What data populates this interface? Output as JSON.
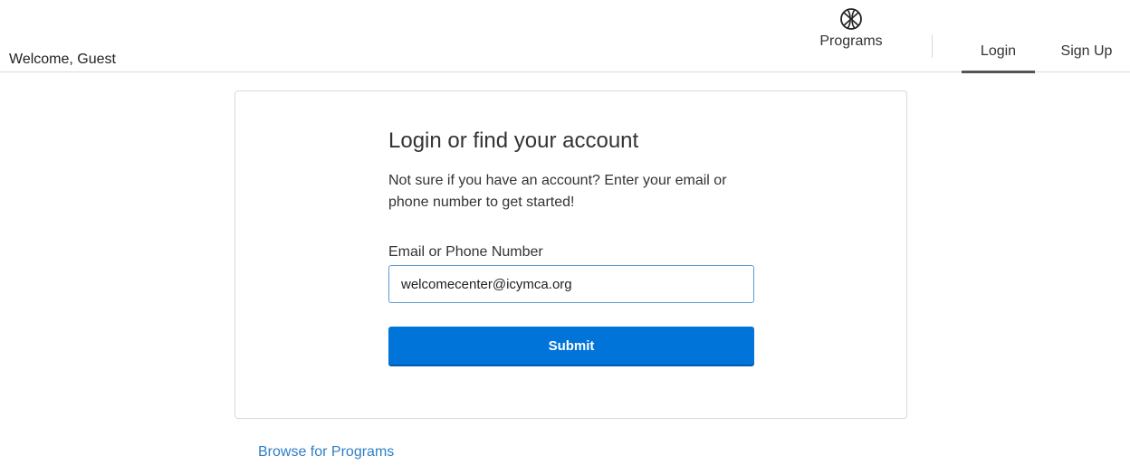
{
  "header": {
    "welcome_text": "Welcome, Guest",
    "nav": {
      "programs_label": "Programs",
      "programs_icon": "basketball-icon",
      "login_label": "Login",
      "signup_label": "Sign Up"
    }
  },
  "login_card": {
    "title": "Login or find your account",
    "description": "Not sure if you have an account? Enter your email or phone number to get started!",
    "field_label": "Email or Phone Number",
    "email_value": "welcomecenter@icymca.org",
    "submit_label": "Submit"
  },
  "footer": {
    "browse_link": "Browse for Programs"
  },
  "colors": {
    "primary_button": "#0074d9",
    "link": "#2f7fc7",
    "input_border_focus": "#5b9bd5"
  }
}
